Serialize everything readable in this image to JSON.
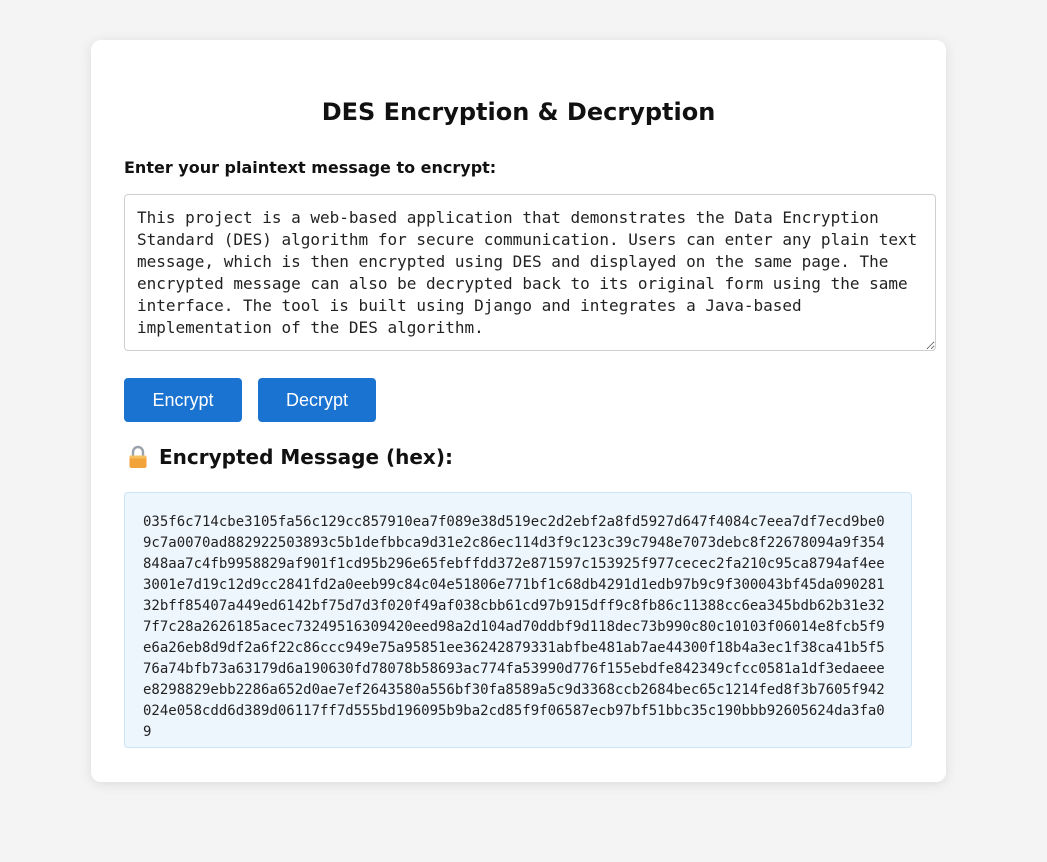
{
  "page": {
    "title": "DES Encryption & Decryption"
  },
  "form": {
    "input_label": "Enter your plaintext message to encrypt:",
    "message": "This project is a web-based application that demonstrates the Data Encryption Standard (DES) algorithm for secure communication. Users can enter any plain text message, which is then encrypted using DES and displayed on the same page. The encrypted message can also be decrypted back to its original form using the same interface. The tool is built using Django and integrates a Java-based implementation of the DES algorithm.",
    "encrypt_label": "Encrypt",
    "decrypt_label": "Decrypt"
  },
  "result": {
    "icon": "lock-icon",
    "heading": "Encrypted Message (hex):",
    "hex": "035f6c714cbe3105fa56c129cc857910ea7f089e38d519ec2d2ebf2a8fd5927d647f4084c7eea7df7ecd9be09c7a0070ad882922503893c5b1defbbca9d31e2c86ec114d3f9c123c39c7948e7073debc8f22678094a9f354848aa7c4fb9958829af901f1cd95b296e65febffdd372e871597c153925f977cecec2fa210c95ca8794af4ee3001e7d19c12d9cc2841fd2a0eeb99c84c04e51806e771bf1c68db4291d1edb97b9c9f300043bf45da09028132bff85407a449ed6142bf75d7d3f020f49af038cbb61cd97b915dff9c8fb86c11388cc6ea345bdb62b31e327f7c28a2626185acec73249516309420eed98a2d104ad70ddbf9d118dec73b990c80c10103f06014e8fcb5f9e6a26eb8d9df2a6f22c86ccc949e75a95851ee36242879331abfbe481ab7ae44300f18b4a3ec1f38ca41b5f576a74bfb73a63179d6a190630fd78078b58693ac774fa53990d776f155ebdfe842349cfcc0581a1df3edaeeee8298829ebb2286a652d0ae7ef2643580a556bf30fa8589a5c9d3368ccb2684bec65c1214fed8f3b7605f942024e058cdd6d389d06117ff7d555bd196095b9ba2cd85f9f06587ecb97bf51bbc35c190bbb92605624da3fa09"
  },
  "colors": {
    "button": "#1a73d0",
    "result_background": "#eef6fd",
    "page_background": "#f4f4f5"
  }
}
